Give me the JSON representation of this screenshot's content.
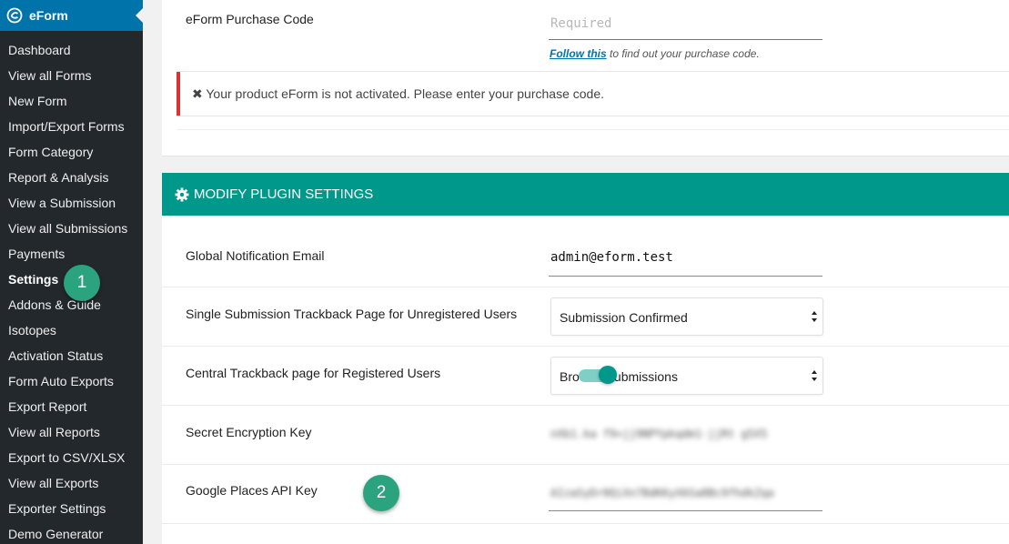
{
  "sidebar": {
    "brand_label": "eForm",
    "items": [
      {
        "label": "Dashboard"
      },
      {
        "label": "View all Forms"
      },
      {
        "label": "New Form"
      },
      {
        "label": "Import/Export Forms"
      },
      {
        "label": "Form Category"
      },
      {
        "label": "Report & Analysis"
      },
      {
        "label": "View a Submission"
      },
      {
        "label": "View all Submissions"
      },
      {
        "label": "Payments"
      },
      {
        "label": "Settings"
      },
      {
        "label": "Addons & Guide"
      },
      {
        "label": "Isotopes"
      },
      {
        "label": "Activation Status"
      },
      {
        "label": "Form Auto Exports"
      },
      {
        "label": "Export Report"
      },
      {
        "label": "View all Reports"
      },
      {
        "label": "Export to CSV/XLSX"
      },
      {
        "label": "View all Exports"
      },
      {
        "label": "Exporter Settings"
      },
      {
        "label": "Demo Generator"
      }
    ],
    "active_item": "Settings"
  },
  "callouts": {
    "one": "1",
    "two": "2"
  },
  "purchase": {
    "label": "eForm Purchase Code",
    "placeholder": "Required",
    "hint_link": "Follow this",
    "hint_rest": " to find out your purchase code.",
    "notice_icon": "✖",
    "notice_text": "Your product eForm is not activated. Please enter your purchase code."
  },
  "settings": {
    "header_title": "MODIFY PLUGIN SETTINGS",
    "header_icon": "gear-icon",
    "global_email_label": "Global Notification Email",
    "global_email_value": "admin@eform.test",
    "single_trackback_label": "Single Submission Trackback Page for Unregistered Users",
    "single_trackback_value": "Submission Confirmed",
    "central_trackback_label": "Central Trackback page for Registered Users",
    "central_trackback_value": "Browse Submissions",
    "secret_key_label": "Secret Encryption Key",
    "secret_key_value": "nXb1.ka f9+jj9NPYpkqdm1-jjRt g5X5",
    "google_key_label": "Google Places API Key",
    "google_key_value": "AIzaSyDr0QiXn7BdKKyX6Sa8Bc9fhdkZqa"
  },
  "colors": {
    "sidebar_bg": "#23282d",
    "brand_bg": "#0073aa",
    "header_teal": "#00988a",
    "badge_green": "#2ba37e",
    "notice_red": "#dc3232"
  }
}
